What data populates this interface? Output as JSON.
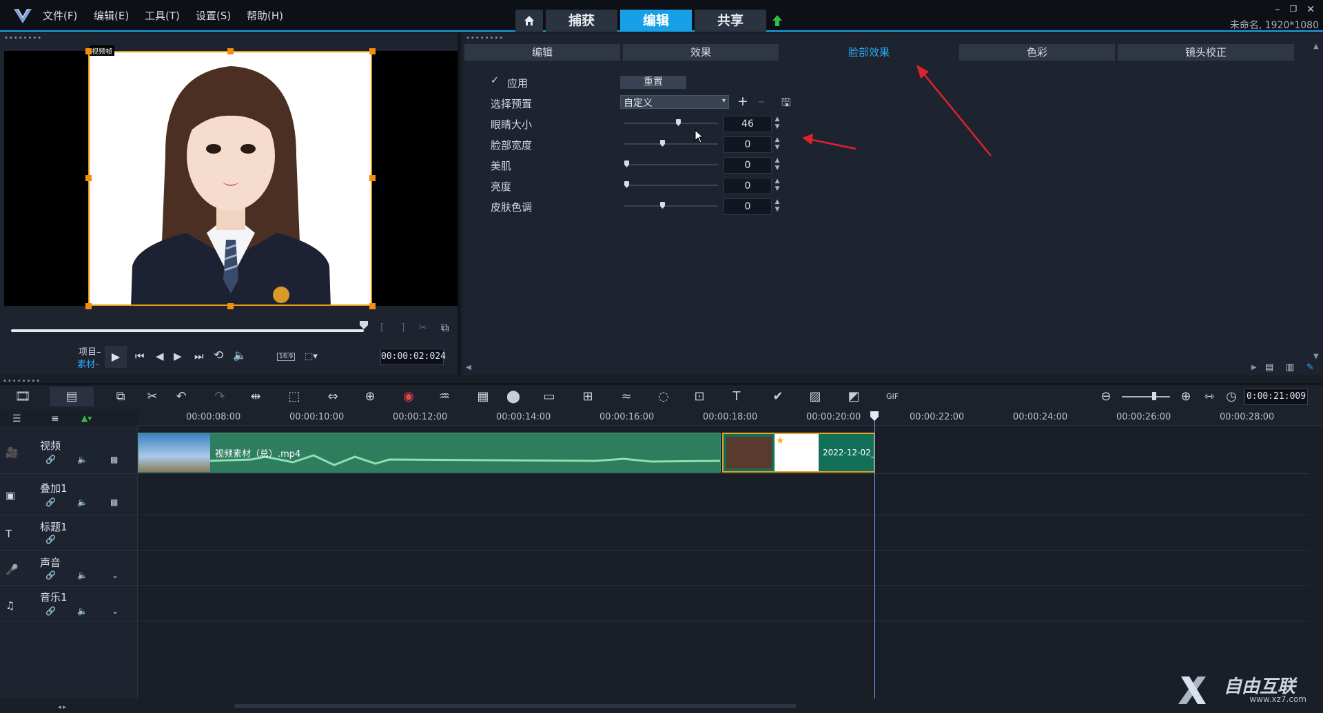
{
  "app": {
    "logo": "V",
    "menus": [
      "文件(F)",
      "编辑(E)",
      "工具(T)",
      "设置(S)",
      "帮助(H)"
    ],
    "steps": [
      "捕获",
      "编辑",
      "共享"
    ],
    "active_step": "编辑",
    "project_info": "未命名, 1920*1080",
    "accent_color": "#17a0e6"
  },
  "preview": {
    "project_label": "项目–",
    "clip_label": "素材–",
    "timecode": "00:00:02:024",
    "aspect": "16:9",
    "clip_badge": "视频帧"
  },
  "options": {
    "tabs": [
      "编辑",
      "效果",
      "脸部效果",
      "色彩",
      "镜头校正"
    ],
    "active_tab": "脸部效果",
    "apply_label": "应用",
    "apply_checked": true,
    "reset_label": "重置",
    "preset_label": "选择预置",
    "preset_value": "自定义",
    "sliders": [
      {
        "label": "眼睛大小",
        "value": "46"
      },
      {
        "label": "脸部宽度",
        "value": "0"
      },
      {
        "label": "美肌",
        "value": "0"
      },
      {
        "label": "亮度",
        "value": "0"
      },
      {
        "label": "皮肤色调",
        "value": "0"
      }
    ],
    "slider_fractions": [
      0.58,
      0.4,
      0.0,
      0.0,
      0.4
    ]
  },
  "timeline": {
    "ticks": [
      "00:00:08:00",
      "00:00:10:00",
      "00:00:12:00",
      "00:00:14:00",
      "00:00:16:00",
      "00:00:18:00",
      "00:00:20:00",
      "00:00:22:00",
      "00:00:24:00",
      "00:00:26:00",
      "00:00:28:00"
    ],
    "timecode": "0:00:21:009",
    "tracks": [
      "视频",
      "叠加1",
      "标题1",
      "声音",
      "音乐1"
    ],
    "clip1_name": "视频素材（总）.mp4",
    "clip2_name": "2022-12-02_"
  },
  "watermark": {
    "brand": "自由互联",
    "url": "www.xz7.com"
  }
}
